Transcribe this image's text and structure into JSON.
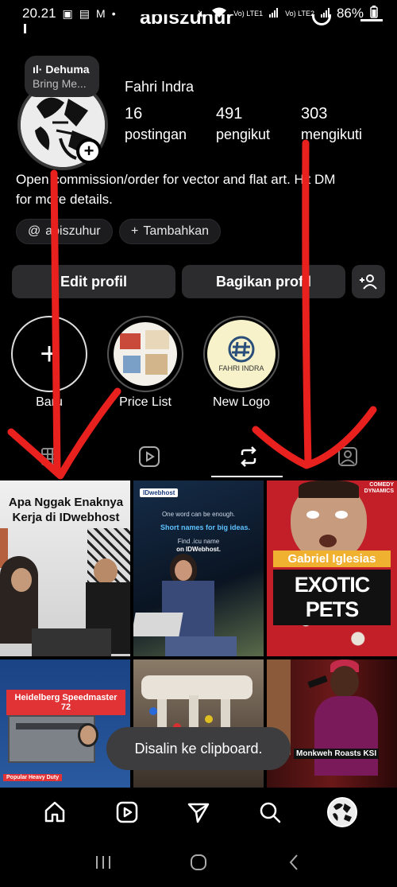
{
  "status_bar": {
    "time": "20.21",
    "battery": "86%",
    "sim1": "Vo) LTE1",
    "sim2": "Vo) LTE2",
    "icons": [
      "image-icon",
      "clipboard-icon",
      "gmail-icon",
      "dot-icon",
      "mute-icon",
      "wifi-icon",
      "signal-icon",
      "battery-icon"
    ]
  },
  "header": {
    "username_partial": "abiszuhur"
  },
  "note": {
    "line1": "Dehuma",
    "line2": "Bring Me..."
  },
  "profile": {
    "name": "Fahri Indra",
    "stats": [
      {
        "value": "16",
        "label": "postingan"
      },
      {
        "value": "491",
        "label": "pengikut"
      },
      {
        "value": "303",
        "label": "mengikuti"
      }
    ],
    "bio_line1": "Open commission/order for vector and flat art. Hit DM",
    "bio_line2": "for more details.",
    "threads_handle": "abiszuhur",
    "add_link_label": "Tambahkan"
  },
  "actions": {
    "edit_profile": "Edit profil",
    "share_profile": "Bagikan profil"
  },
  "highlights": [
    {
      "label": "Baru"
    },
    {
      "label": "Price List"
    },
    {
      "label": "New Logo",
      "logo_text": "FAHRI INDRA"
    }
  ],
  "tabs": [
    "grid-icon",
    "reels-icon",
    "reposts-icon",
    "tagged-icon"
  ],
  "posts": [
    {
      "caption": "Apa Nggak Enaknya Kerja di IDwebhost"
    },
    {
      "brand": "IDwebhost",
      "line1": "One word can be enough.",
      "line2": "Short names for big ideas.",
      "line3": "Find .icu name",
      "line4": "on IDWebhost."
    },
    {
      "badge": "COMEDY DYNAMICS",
      "subtitle": "Gabriel Iglesias",
      "title": "EXOTIC PETS"
    },
    {
      "caption": "Heidelberg Speedmaster 72",
      "tag": "Popular Heavy Duty"
    },
    {
      "caption": ""
    },
    {
      "caption": "Monkweh Roasts KSI"
    }
  ],
  "toast": "Disalin ke clipboard.",
  "colors": {
    "background": "#000000",
    "button": "#2c2c2e",
    "annotation_arrow": "#e8201e",
    "toast": "#3d3d40"
  }
}
